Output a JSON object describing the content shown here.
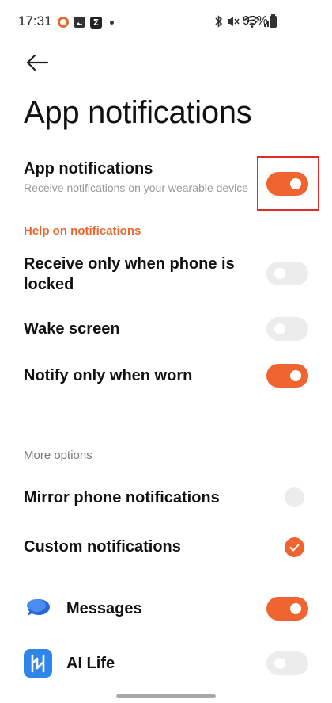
{
  "status_bar": {
    "time": "17:31",
    "battery_percent": "93%",
    "left_icons": [
      "ring-icon",
      "gallery-icon",
      "sigma-icon",
      "dot-icon"
    ],
    "right_icons": [
      "bluetooth-icon",
      "mute-icon",
      "wifi-icon",
      "signal-icon",
      "battery-icon"
    ]
  },
  "header": {
    "back_icon": "arrow-left-icon",
    "title": "App notifications"
  },
  "main_setting": {
    "title": "App notifications",
    "subtitle": "Receive notifications on your wearable device",
    "enabled": true
  },
  "help_link": "Help on notifications",
  "settings": [
    {
      "label": "Receive only when phone is locked",
      "enabled": false
    },
    {
      "label": "Wake screen",
      "enabled": false
    },
    {
      "label": "Notify only when worn",
      "enabled": true
    }
  ],
  "more_options": {
    "header": "More options",
    "options": [
      {
        "label": "Mirror phone notifications",
        "selected": false
      },
      {
        "label": "Custom notifications",
        "selected": true
      }
    ]
  },
  "apps": [
    {
      "name": "Messages",
      "icon": "messages-icon",
      "enabled": true
    },
    {
      "name": "AI Life",
      "icon": "ai-life-icon",
      "enabled": false
    }
  ],
  "colors": {
    "accent": "#f0652f",
    "toggle_off": "#ececec",
    "highlight": "#e32b2b"
  }
}
